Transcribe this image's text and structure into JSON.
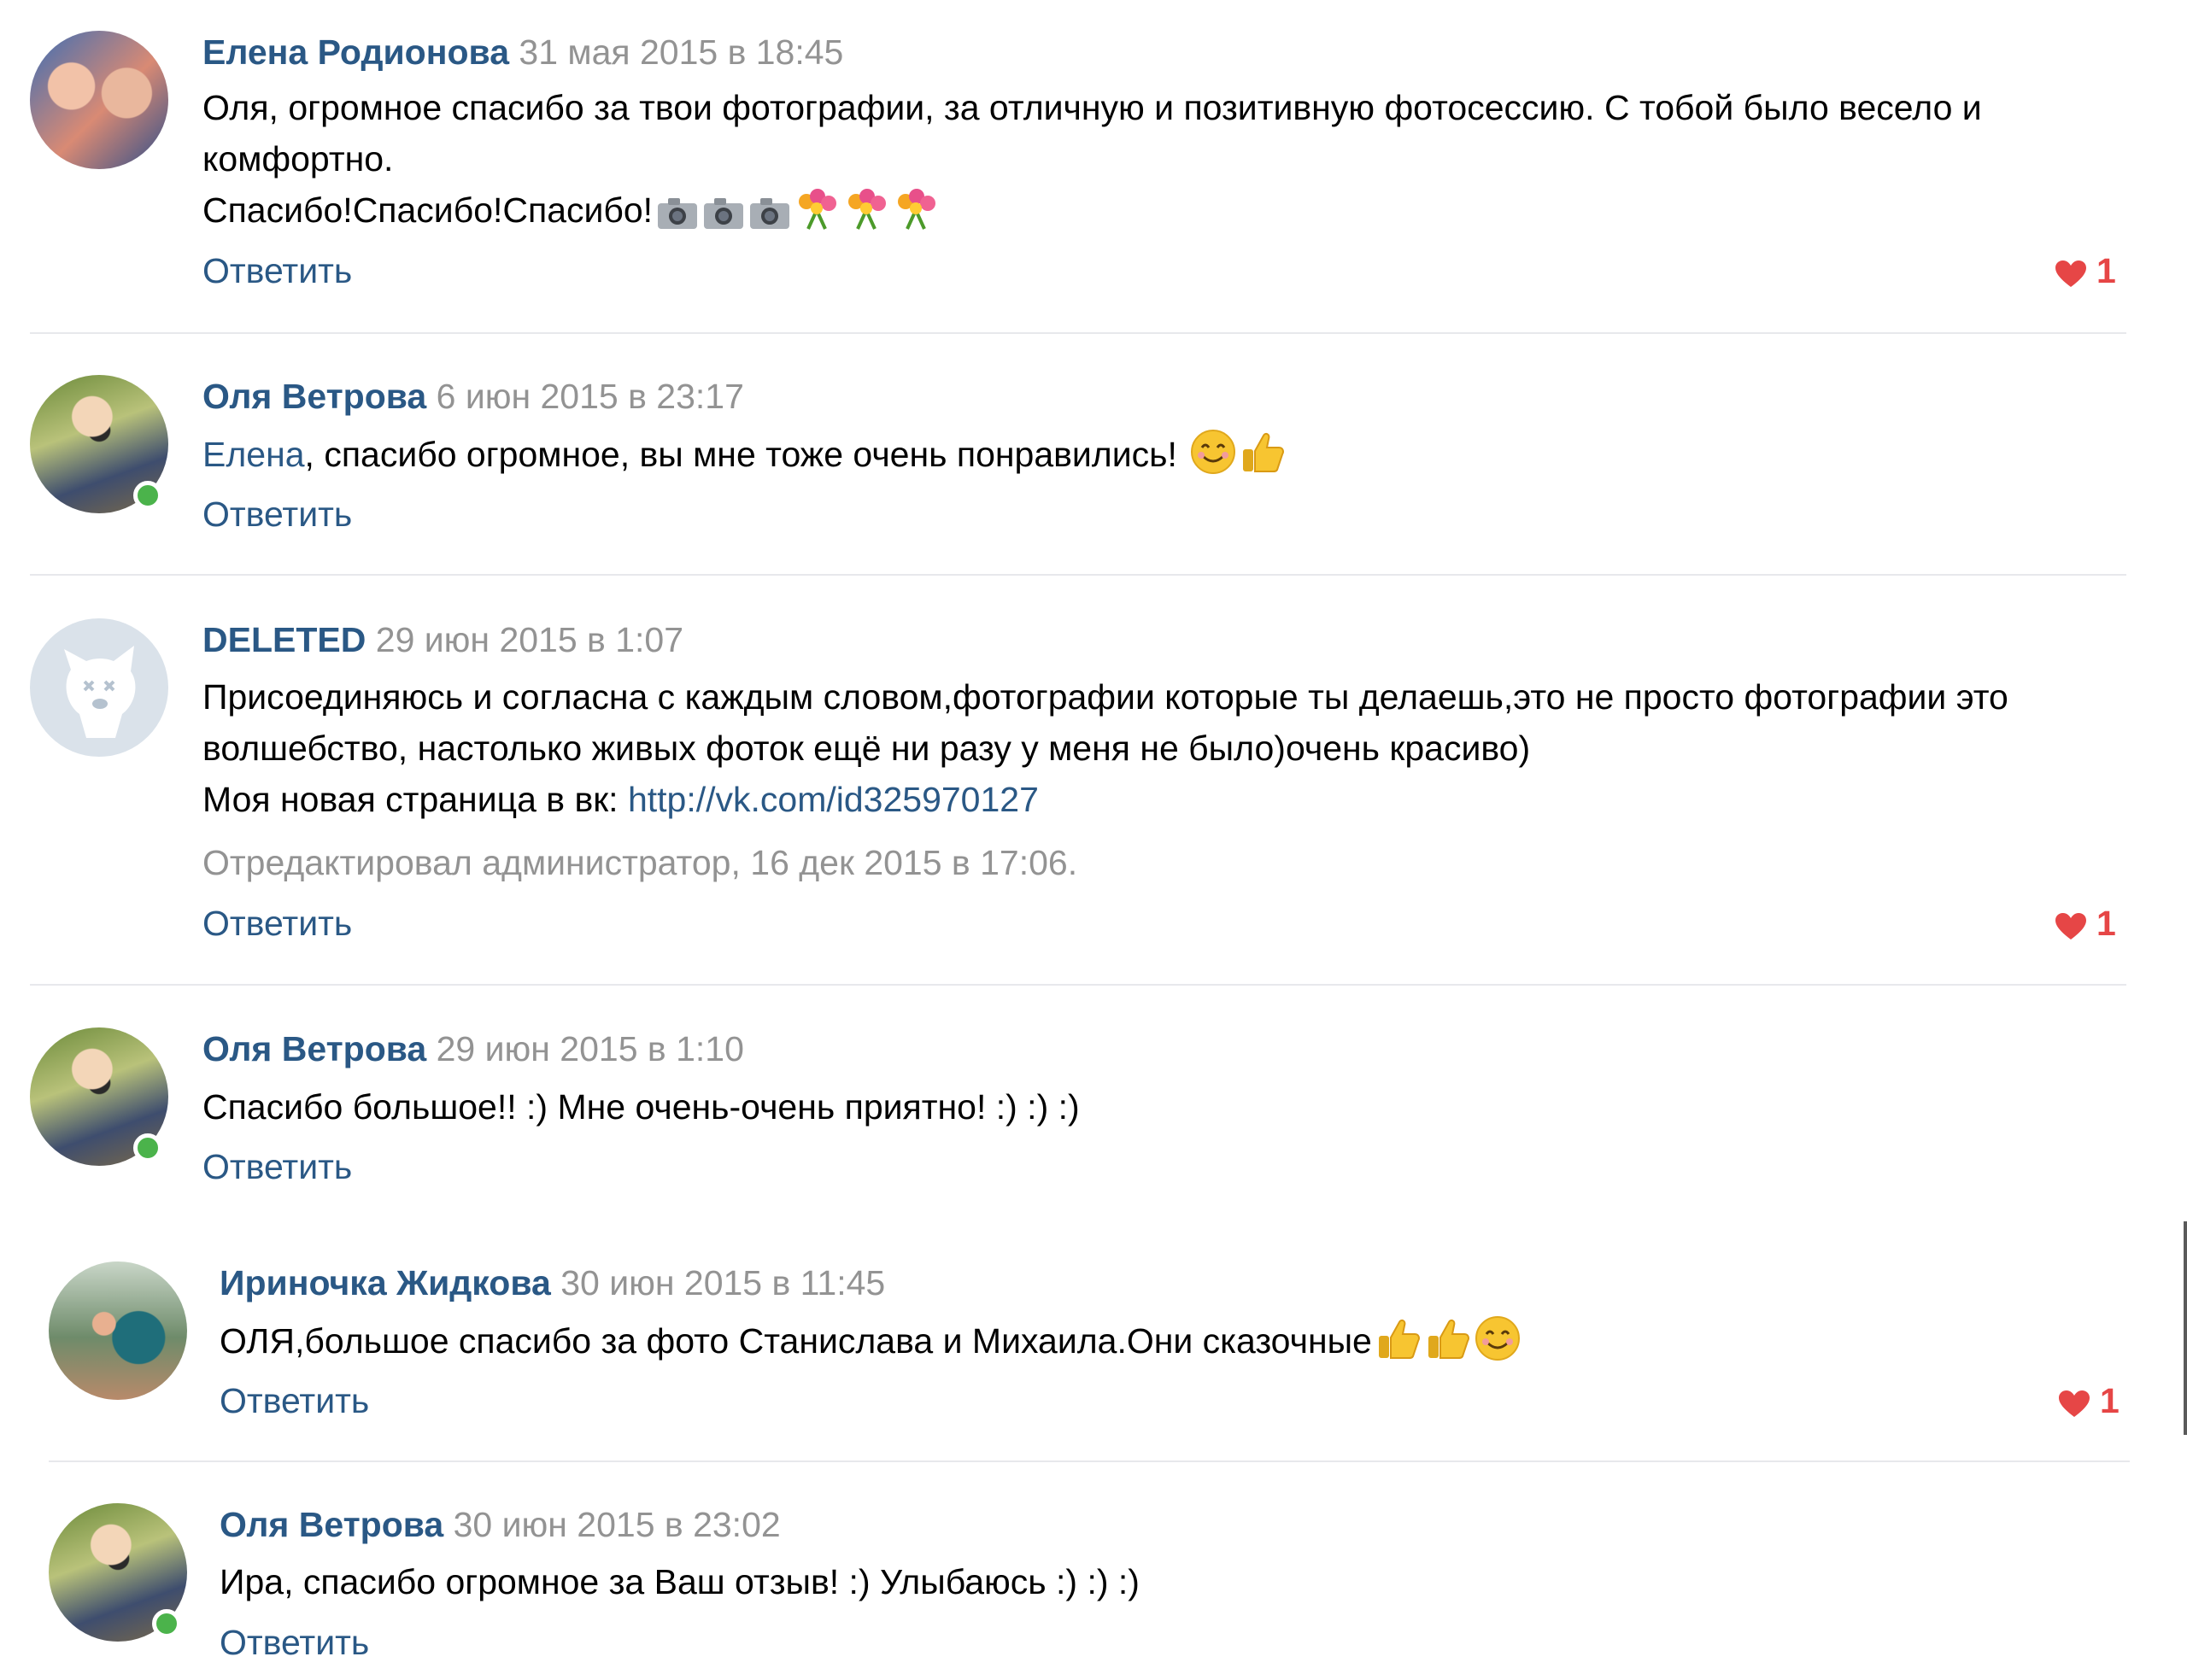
{
  "comments": [
    {
      "author": "Елена Родионова",
      "date": "31 мая 2015 в 18:45",
      "text_line1": "Оля, огромное спасибо за твои фотографии, за отличную и позитивную фотосессию. С тобой было весело и",
      "text_line2": "комфортно.",
      "text_line3": "Спасибо!Спасибо!Спасибо!",
      "reply_label": "Ответить",
      "likes": "1"
    },
    {
      "author": "Оля Ветрова",
      "date": "6 июн 2015 в 23:17",
      "mention": "Елена",
      "text": ", спасибо огромное, вы мне тоже очень понравились!",
      "reply_label": "Ответить"
    },
    {
      "author": "DELETED",
      "date": "29 июн 2015 в 1:07",
      "text_line1": "Присоединяюсь и согласна с каждым словом,фотографии которые ты делаешь,это не просто фотографии это",
      "text_line2": "волшебство, настолько живых фоток ещё ни разу у меня не было)очень красиво)",
      "text_line3_prefix": "Моя новая страница в вк: ",
      "link": "http://vk.com/id325970127",
      "edited": "Отредактировал администратор, 16 дек 2015 в 17:06.",
      "reply_label": "Ответить",
      "likes": "1"
    },
    {
      "author": "Оля Ветрова",
      "date": "29 июн 2015 в 1:10",
      "text": "Спасибо большое!! :) Мне очень-очень приятно! :) :) :)",
      "reply_label": "Ответить"
    },
    {
      "author": "Ириночка Жидкова",
      "date": "30 июн 2015 в 11:45",
      "text": "ОЛЯ,большое спасибо за фото Станислава и Михаила.Они сказочные",
      "reply_label": "Ответить",
      "likes": "1"
    },
    {
      "author": "Оля Ветрова",
      "date": "30 июн 2015 в 23:02",
      "text": "Ира, спасибо огромное за Ваш отзыв! :) Улыбаюсь :) :) :)",
      "reply_label": "Ответить"
    }
  ],
  "colors": {
    "link": "#2a5885",
    "meta": "#939393",
    "like": "#e64646",
    "online": "#4bb34b",
    "divider": "#e7e8ec"
  },
  "icons": [
    "camera-icon",
    "flowers-icon",
    "smile-icon",
    "thumbs-up-icon",
    "heart-icon",
    "deleted-dog-icon"
  ]
}
